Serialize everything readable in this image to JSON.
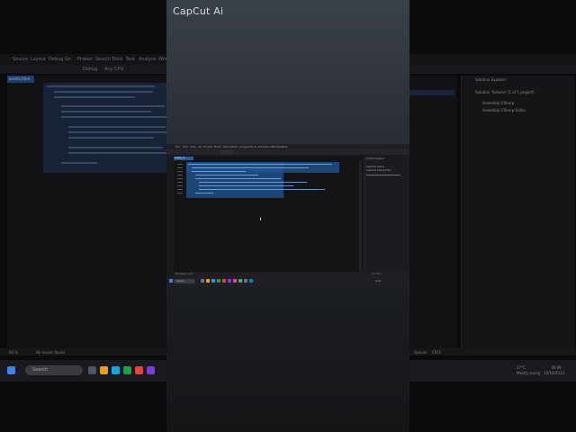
{
  "watermark": {
    "text": "CapCut Ai"
  },
  "background": {
    "menu_items": [
      "Source",
      "Layout",
      "Debug",
      "Go",
      "Project",
      "Search",
      "Tools",
      "Test",
      "Analyze",
      "Window"
    ],
    "toolbar": {
      "config": "Debug",
      "platform": "Any CPU"
    },
    "tab_label": "assets.html",
    "solution_items": [
      "Solution Explorer",
      "Solution 'Volume' (1 of 1 project)",
      "Assembly-CSharp",
      "Assembly-CSharp-Editor"
    ],
    "status_left": "60 %",
    "status_issues": "No issues found",
    "status_right": [
      "Spaces",
      "CRLF"
    ],
    "search_placeholder": "Search",
    "tray": {
      "temp": "27°C",
      "weather": "Mostly sunny",
      "time": "16:09",
      "date": "10/16/2024"
    },
    "colors": {
      "accent": "#1e4f8a",
      "bg": "#0b0b0d"
    }
  },
  "inner": {
    "menu_items": [
      "File",
      "Edit",
      "View",
      "Git",
      "Project",
      "Build",
      "Debug",
      "Test",
      "Analyze",
      "Tools",
      "Extensions",
      "Window",
      "Help"
    ],
    "tab_label": "assets.cs",
    "right_panel": [
      "Solution Explorer",
      "Assembly-CSharp",
      "Assembly-CSharp-Editor"
    ],
    "status_left": "No issues found",
    "status_right": "Ln 1 Ch 1",
    "search_placeholder": "Search"
  }
}
